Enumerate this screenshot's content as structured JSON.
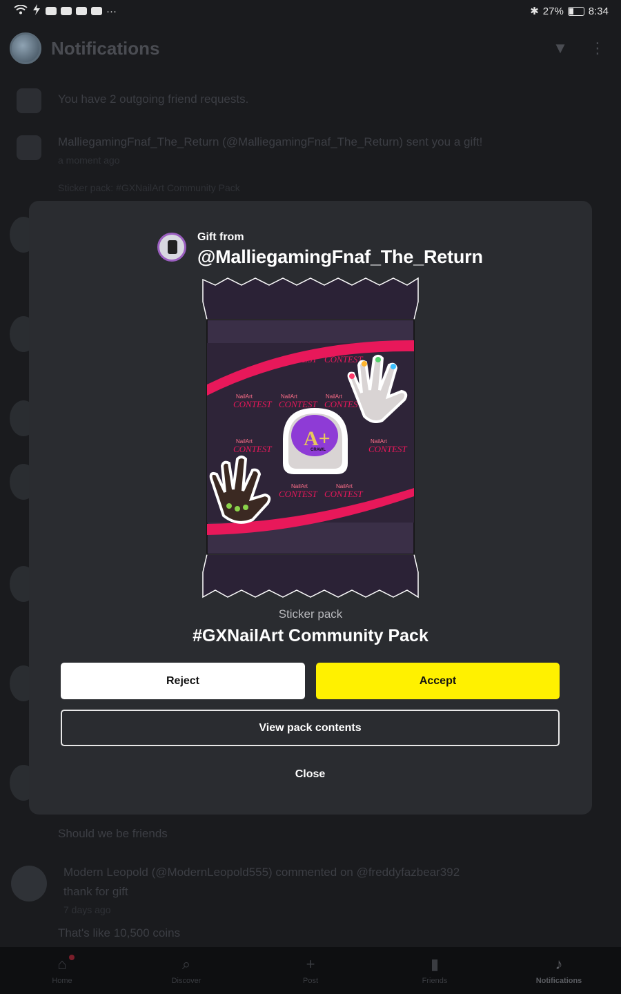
{
  "status_bar": {
    "icons_left": [
      "wifi-icon",
      "charging-icon",
      "app-icons"
    ],
    "more": "···",
    "bluetooth": "✱",
    "battery_percent": "27%",
    "time": "8:34"
  },
  "header": {
    "title": "Notifications"
  },
  "background_notifications": [
    {
      "text": "You have 2 outgoing friend requests."
    },
    {
      "text": "MalliegamingFnaf_The_Return (@MalliegamingFnaf_The_Return) sent you a gift!",
      "time": "a moment ago",
      "detail": "Sticker pack: #GXNailArt Community Pack"
    },
    {
      "text": "Should we be friends"
    },
    {
      "text": "Modern Leopold (@ModernLeopold555) commented on @freddyfazbear392",
      "detail": "thank for gift",
      "time": "7 days ago"
    },
    {
      "text": "That's like 10,500 coins"
    }
  ],
  "modal": {
    "gift_label": "Gift from",
    "giver_handle": "@MalliegamingFnaf_The_Return",
    "pack_type": "Sticker pack",
    "pack_name": "#GXNailArt Community Pack",
    "reject_label": "Reject",
    "accept_label": "Accept",
    "view_label": "View pack contents",
    "close_label": "Close"
  },
  "pack_art": {
    "brand": "NailArt",
    "word": "CONTEST",
    "badge": "A+",
    "badge_sub": "CRAWL"
  },
  "bottom_nav": [
    {
      "label": "Home",
      "icon": "home-icon"
    },
    {
      "label": "Discover",
      "icon": "search-icon"
    },
    {
      "label": "Post",
      "icon": "plus-icon"
    },
    {
      "label": "Friends",
      "icon": "chat-icon"
    },
    {
      "label": "Notifications",
      "icon": "bell-icon"
    }
  ],
  "colors": {
    "accent": "#fff100",
    "modal_bg": "#2a2c30",
    "page_bg": "#1a1b1e",
    "pack_stripe": "#e8185a"
  }
}
